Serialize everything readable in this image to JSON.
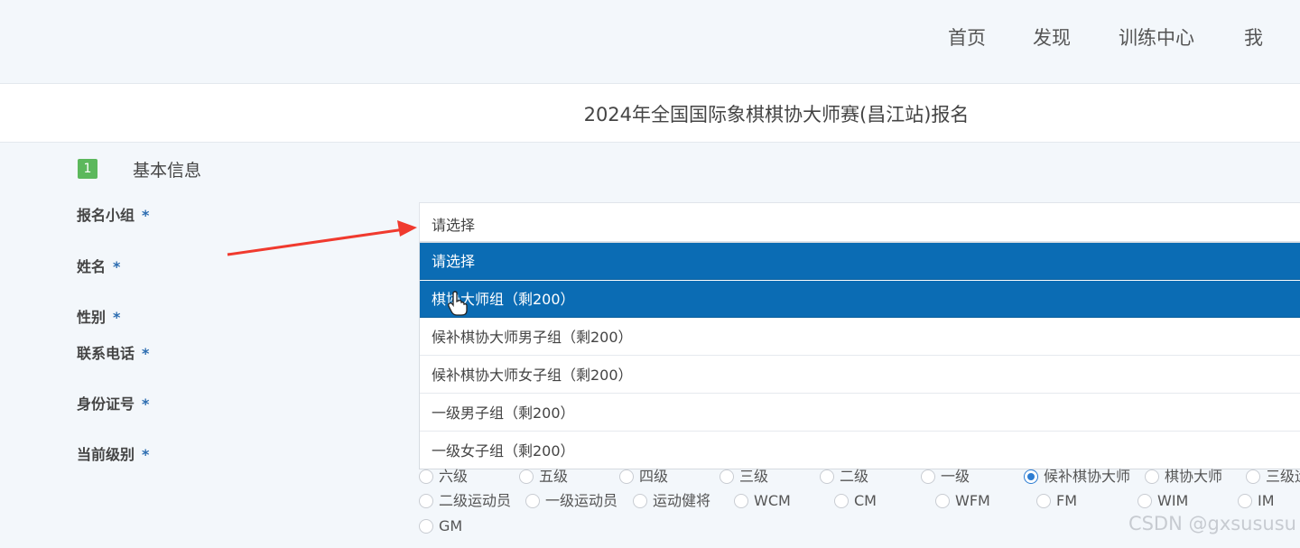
{
  "nav": {
    "items": [
      "首页",
      "发现",
      "训练中心",
      "我"
    ]
  },
  "page": {
    "title": "2024年全国国际象棋棋协大师赛(昌江站)报名"
  },
  "section": {
    "number": "1",
    "title": "基本信息"
  },
  "form": {
    "required_mark": "*",
    "labels": [
      "报名小组",
      "姓名",
      "性别",
      "联系电话",
      "身份证号",
      "当前级别"
    ],
    "group_select": {
      "value": "请选择",
      "options": [
        "请选择",
        "棋协大师组（剩200）",
        "候补棋协大师男子组（剩200）",
        "候补棋协大师女子组（剩200）",
        "一级男子组（剩200）",
        "一级女子组（剩200）"
      ],
      "highlighted_index": 1
    },
    "level_options": [
      "六级",
      "五级",
      "四级",
      "三级",
      "二级",
      "一级",
      "候补棋协大师",
      "棋协大师",
      "三级运",
      "二级运动员",
      "一级运动员",
      "运动健将",
      "WCM",
      "CM",
      "WFM",
      "FM",
      "WIM",
      "IM",
      "GM"
    ],
    "level_selected": "候补棋协大师"
  },
  "colors": {
    "accent": "#0b6cb4",
    "badge": "#5cb85c",
    "arrow": "#f03a2e"
  },
  "watermark": "CSDN @gxsususu"
}
